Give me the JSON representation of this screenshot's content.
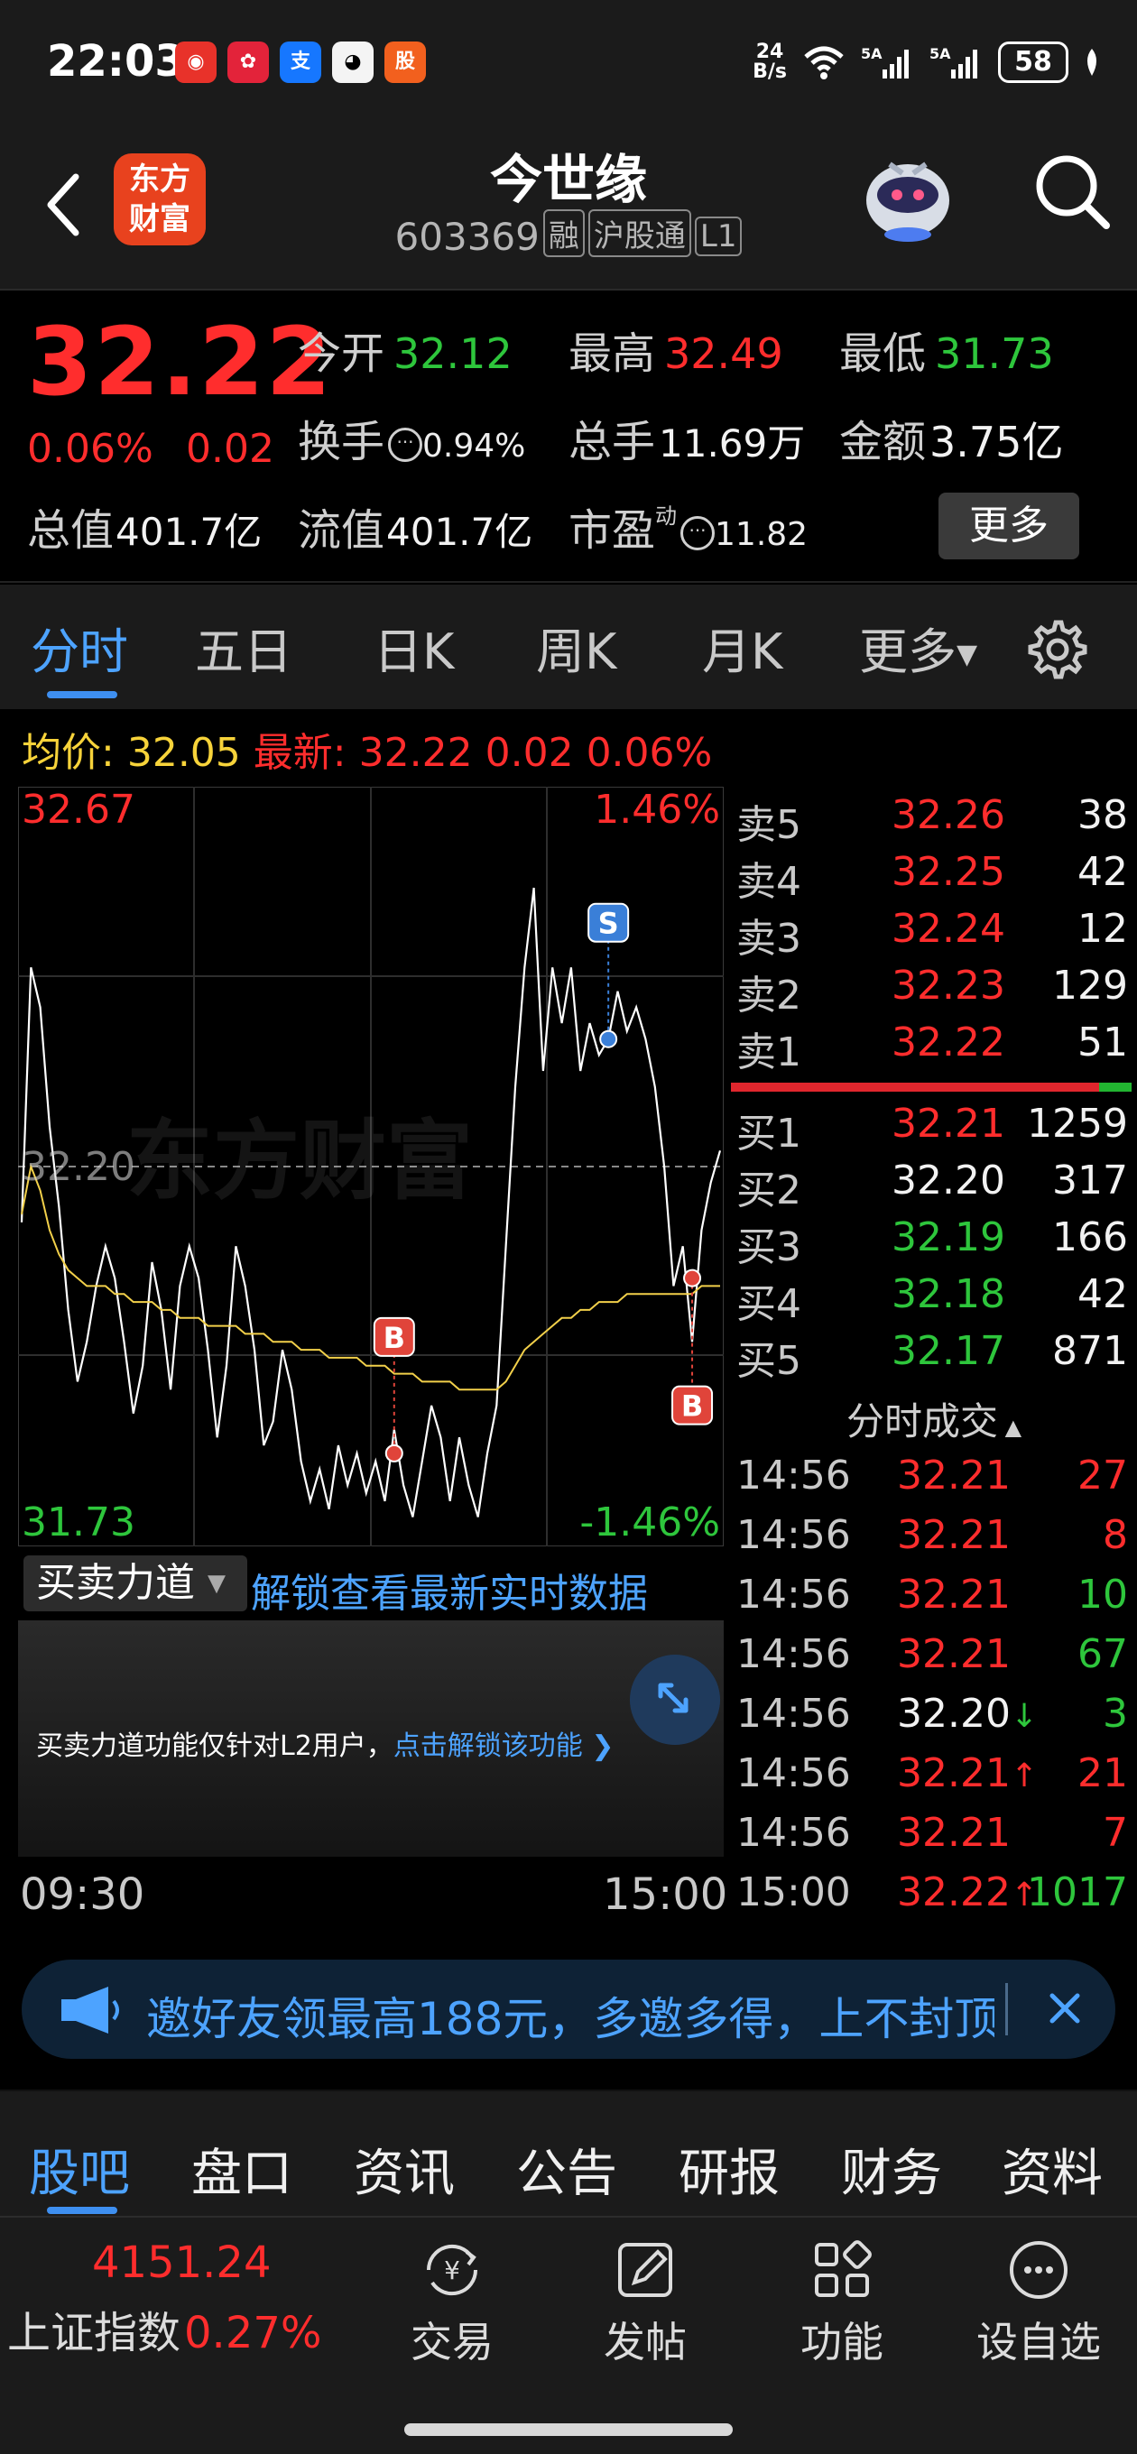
{
  "status_bar": {
    "time": "22:03",
    "net_speed_top": "24",
    "net_speed_bottom": "B/s",
    "battery": "58",
    "app_icons": [
      "taobao-icon",
      "pinduoduo-icon",
      "alipay-icon",
      "qq-icon",
      "guba-icon"
    ]
  },
  "header": {
    "logo_line1": "东方",
    "logo_line2": "财富",
    "stock_name": "今世缘",
    "stock_code": "603369",
    "tags": [
      "融",
      "沪股通",
      "L1"
    ]
  },
  "quote": {
    "price": "32.22",
    "change_pct": "0.06%",
    "change": "0.02",
    "open_label": "今开",
    "open": "32.12",
    "high_label": "最高",
    "high": "32.49",
    "low_label": "最低",
    "low": "31.73",
    "turnover_label": "换手",
    "turnover": "0.94%",
    "volume_label": "总手",
    "volume": "11.69万",
    "amount_label": "金额",
    "amount": "3.75亿",
    "mktcap_label": "总值",
    "mktcap": "401.7亿",
    "float_label": "流值",
    "float_cap": "401.7亿",
    "pe_label": "市盈",
    "pe_sup": "动",
    "pe": "11.82",
    "more_button": "更多"
  },
  "period_tabs": [
    "分时",
    "五日",
    "日K",
    "周K",
    "月K",
    "更多"
  ],
  "info_line": {
    "avg_label": "均价:",
    "avg": "32.05",
    "latest_label": "最新:",
    "latest": "32.22",
    "latest_chg": "0.02",
    "latest_pct": "0.06%"
  },
  "chart_data": {
    "type": "line",
    "title": "",
    "y_top_price": "32.67",
    "y_top_pct": "1.46%",
    "y_bottom_price": "31.73",
    "y_bottom_pct": "-1.46%",
    "prev_close_label": "32.20",
    "prev_close": 32.2,
    "ylim": [
      31.73,
      32.67
    ],
    "x_start": "09:30",
    "x_end": "15:00",
    "watermark": "东方财富",
    "series": [
      {
        "name": "",
        "color": "#ffffff",
        "values": [
          32.13,
          32.45,
          32.4,
          32.25,
          32.15,
          32.02,
          31.93,
          31.98,
          32.05,
          32.1,
          32.06,
          31.98,
          31.89,
          31.95,
          32.08,
          32.02,
          31.92,
          32.05,
          32.1,
          32.06,
          31.97,
          31.86,
          31.95,
          32.1,
          32.05,
          31.97,
          31.85,
          31.88,
          31.97,
          31.92,
          31.83,
          31.78,
          31.82,
          31.77,
          31.85,
          31.8,
          31.84,
          31.79,
          31.83,
          31.78,
          31.87,
          31.8,
          31.76,
          31.83,
          31.9,
          31.86,
          31.78,
          31.86,
          31.8,
          31.76,
          31.84,
          31.9,
          32.1,
          32.3,
          32.45,
          32.55,
          32.32,
          32.45,
          32.38,
          32.45,
          32.32,
          32.38,
          32.34,
          32.36,
          32.42,
          32.37,
          32.4,
          32.36,
          32.3,
          32.2,
          32.05,
          32.1,
          31.98,
          32.12,
          32.18,
          32.22
        ]
      },
      {
        "name": "",
        "color": "#f2d04a",
        "values": [
          32.14,
          32.2,
          32.17,
          32.12,
          32.09,
          32.07,
          32.06,
          32.05,
          32.05,
          32.05,
          32.04,
          32.04,
          32.03,
          32.03,
          32.03,
          32.02,
          32.02,
          32.01,
          32.01,
          32.01,
          32.0,
          32.0,
          32.0,
          32.0,
          31.99,
          31.99,
          31.99,
          31.98,
          31.98,
          31.98,
          31.97,
          31.97,
          31.97,
          31.96,
          31.96,
          31.96,
          31.96,
          31.95,
          31.95,
          31.95,
          31.94,
          31.94,
          31.94,
          31.93,
          31.93,
          31.93,
          31.93,
          31.92,
          31.92,
          31.92,
          31.92,
          31.92,
          31.93,
          31.95,
          31.97,
          31.98,
          31.99,
          32.0,
          32.01,
          32.01,
          32.02,
          32.02,
          32.03,
          32.03,
          32.03,
          32.04,
          32.04,
          32.04,
          32.04,
          32.04,
          32.04,
          32.04,
          32.04,
          32.05,
          32.05,
          32.05
        ]
      }
    ],
    "markers": [
      {
        "label": "B",
        "color": "#e0443a",
        "index": 40,
        "y": 31.84,
        "side": "above"
      },
      {
        "label": "S",
        "color": "#3a7fd8",
        "index": 63,
        "y": 32.36,
        "side": "above"
      },
      {
        "label": "B",
        "color": "#e0443a",
        "index": 72,
        "y": 32.06,
        "side": "below"
      }
    ]
  },
  "order_book": {
    "asks": [
      {
        "label": "卖5",
        "price": "32.26",
        "vol": "38",
        "color": "red"
      },
      {
        "label": "卖4",
        "price": "32.25",
        "vol": "42",
        "color": "red"
      },
      {
        "label": "卖3",
        "price": "32.24",
        "vol": "12",
        "color": "red"
      },
      {
        "label": "卖2",
        "price": "32.23",
        "vol": "129",
        "color": "red"
      },
      {
        "label": "卖1",
        "price": "32.22",
        "vol": "51",
        "color": "red"
      }
    ],
    "bids": [
      {
        "label": "买1",
        "price": "32.21",
        "vol": "1259",
        "color": "red"
      },
      {
        "label": "买2",
        "price": "32.20",
        "vol": "317",
        "color": "white"
      },
      {
        "label": "买3",
        "price": "32.19",
        "vol": "166",
        "color": "green"
      },
      {
        "label": "买4",
        "price": "32.18",
        "vol": "42",
        "color": "green"
      },
      {
        "label": "买5",
        "price": "32.17",
        "vol": "871",
        "color": "green"
      }
    ],
    "buy_sell_ratio": 0.92,
    "trades_header": "分时成交",
    "trades": [
      {
        "time": "14:56",
        "price": "32.21",
        "arrow": "",
        "qty": "27",
        "pcolor": "red",
        "qcolor": "red"
      },
      {
        "time": "14:56",
        "price": "32.21",
        "arrow": "",
        "qty": "8",
        "pcolor": "red",
        "qcolor": "red"
      },
      {
        "time": "14:56",
        "price": "32.21",
        "arrow": "",
        "qty": "10",
        "pcolor": "red",
        "qcolor": "green"
      },
      {
        "time": "14:56",
        "price": "32.21",
        "arrow": "",
        "qty": "67",
        "pcolor": "red",
        "qcolor": "green"
      },
      {
        "time": "14:56",
        "price": "32.20",
        "arrow": "↓",
        "qty": "3",
        "pcolor": "white",
        "qcolor": "green"
      },
      {
        "time": "14:56",
        "price": "32.21",
        "arrow": "↑",
        "qty": "21",
        "pcolor": "red",
        "qcolor": "red"
      },
      {
        "time": "14:56",
        "price": "32.21",
        "arrow": "",
        "qty": "7",
        "pcolor": "red",
        "qcolor": "red"
      },
      {
        "time": "15:00",
        "price": "32.22",
        "arrow": "↑",
        "qty": "1017",
        "pcolor": "red",
        "qcolor": "green"
      }
    ]
  },
  "l2": {
    "selector": "买卖力道",
    "unlock_link": "解锁查看最新实时数据",
    "panel_text": "买卖力道功能仅针对L2用户，",
    "panel_link": "点击解锁该功能"
  },
  "promo": {
    "text": "邀好友领最高188元，多邀多得，上不封顶"
  },
  "bottom_tabs": [
    "股吧",
    "盘口",
    "资讯",
    "公告",
    "研报",
    "财务",
    "资料"
  ],
  "bottom_nav": {
    "index_value": "4151.24",
    "index_name": "上证指数",
    "index_pct": "0.27%",
    "items": [
      "交易",
      "发帖",
      "功能",
      "设自选"
    ]
  }
}
